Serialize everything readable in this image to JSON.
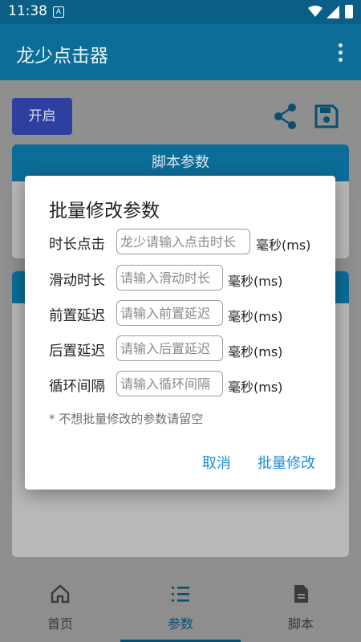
{
  "status_bar": {
    "time": "11:38",
    "notification_icon": "A"
  },
  "app_bar": {
    "title": "龙少点击器",
    "menu_icon": "more-vert-icon"
  },
  "toolbar": {
    "start_label": "开启",
    "share_icon": "share-icon",
    "save_icon": "save-icon"
  },
  "card1": {
    "header": "脚本参数"
  },
  "bottom_nav": {
    "items": [
      {
        "label": "首页",
        "icon": "home-icon"
      },
      {
        "label": "参数",
        "icon": "list-icon"
      },
      {
        "label": "脚本",
        "icon": "document-icon"
      }
    ],
    "active_index": 1
  },
  "dialog": {
    "title": "批量修改参数",
    "fields": [
      {
        "label": "时长点击",
        "placeholder": "龙少请输入点击时长",
        "unit": "毫秒(ms)"
      },
      {
        "label": "滑动时长",
        "placeholder": "请输入滑动时长",
        "unit": "毫秒(ms)"
      },
      {
        "label": "前置延迟",
        "placeholder": "请输入前置延迟",
        "unit": "毫秒(ms)"
      },
      {
        "label": "后置延迟",
        "placeholder": "请输入后置延迟",
        "unit": "毫秒(ms)"
      },
      {
        "label": "循环间隔",
        "placeholder": "请输入循环间隔",
        "unit": "毫秒(ms)"
      }
    ],
    "note": "* 不想批量修改的参数请留空",
    "cancel_label": "取消",
    "confirm_label": "批量修改"
  }
}
